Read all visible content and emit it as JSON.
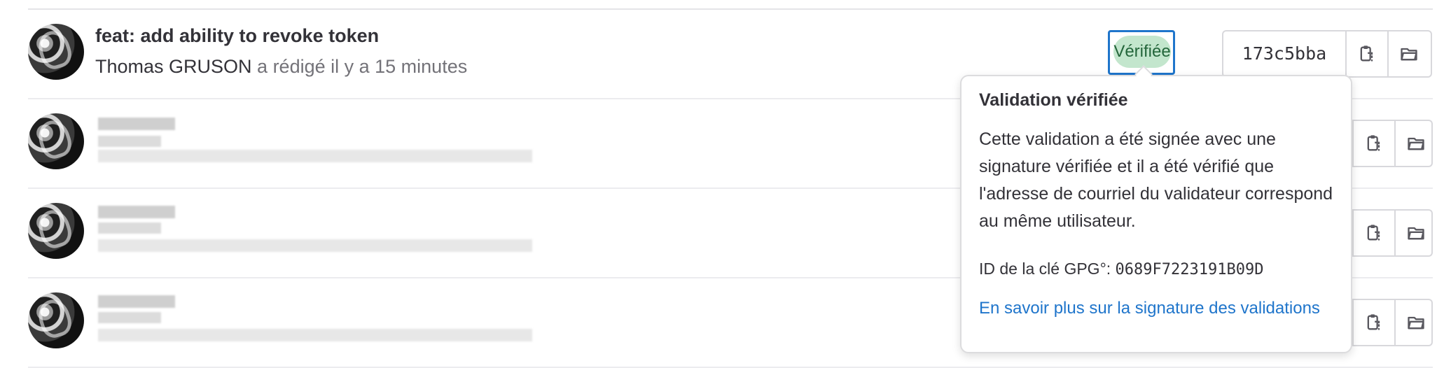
{
  "commits": [
    {
      "title": "feat: add ability to revoke token",
      "author": "Thomas GRUSON",
      "meta_suffix": " a rédigé il y a 15 minutes",
      "status": "Vérifiée",
      "sha": "173c5bba"
    },
    {
      "title": "",
      "author": "",
      "meta_suffix": "",
      "status": "",
      "sha": ""
    },
    {
      "title": "",
      "author": "",
      "meta_suffix": "",
      "status": "",
      "sha": ""
    },
    {
      "title": "",
      "author": "",
      "meta_suffix": "",
      "status": "",
      "sha": ""
    }
  ],
  "tooltip": {
    "title": "Validation vérifiée",
    "body": "Cette validation a été signée avec une signature vérifiée et il a été vérifié que l'adresse de courriel du validateur correspond au même utilisateur.",
    "gpg_label": "ID de la clé GPG°:",
    "gpg_id": "0689F7223191B09D",
    "learn_more": "En savoir plus sur la signature des validations"
  },
  "icons": {
    "copy": "copy-to-clipboard-icon",
    "browse": "folder-open-icon"
  },
  "colors": {
    "accent": "#1f75cb",
    "verified_bg": "#c3e6cd",
    "verified_text": "#24663b"
  }
}
